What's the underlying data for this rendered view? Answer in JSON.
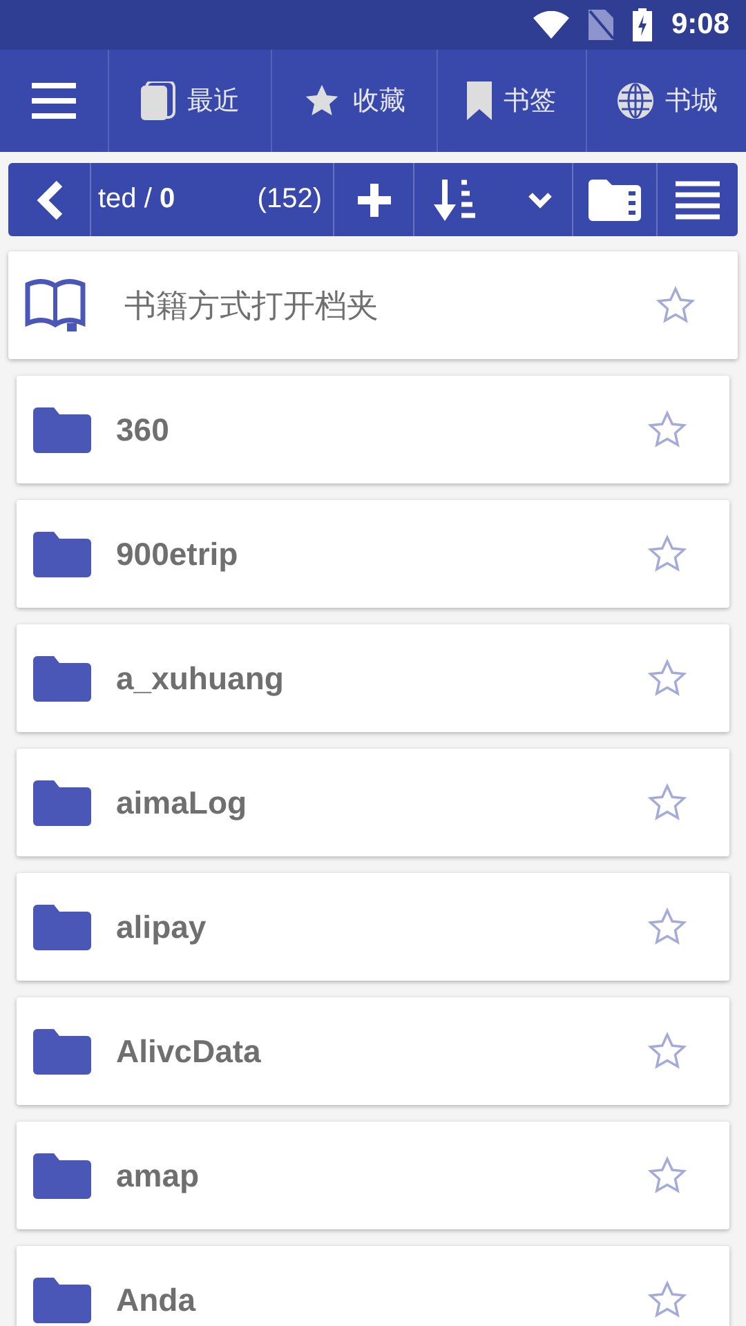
{
  "status_bar": {
    "time": "9:08"
  },
  "tabs": [
    {
      "label": "最近",
      "kind": "recent"
    },
    {
      "label": "收藏",
      "kind": "favorites"
    },
    {
      "label": "书签",
      "kind": "bookmarks"
    },
    {
      "label": "书城",
      "kind": "store"
    }
  ],
  "toolbar": {
    "path": "ted / **0**",
    "count": "(152)"
  },
  "book_mode": {
    "label": "书籍方式打开档夹",
    "favorite": false
  },
  "folders": [
    {
      "name": "360",
      "favorite": false
    },
    {
      "name": "900etrip",
      "favorite": false
    },
    {
      "name": "a_xuhuang",
      "favorite": false
    },
    {
      "name": "aimaLog",
      "favorite": false
    },
    {
      "name": "alipay",
      "favorite": false
    },
    {
      "name": "AlivcData",
      "favorite": false
    },
    {
      "name": "amap",
      "favorite": false
    },
    {
      "name": "Anda",
      "favorite": false
    }
  ]
}
